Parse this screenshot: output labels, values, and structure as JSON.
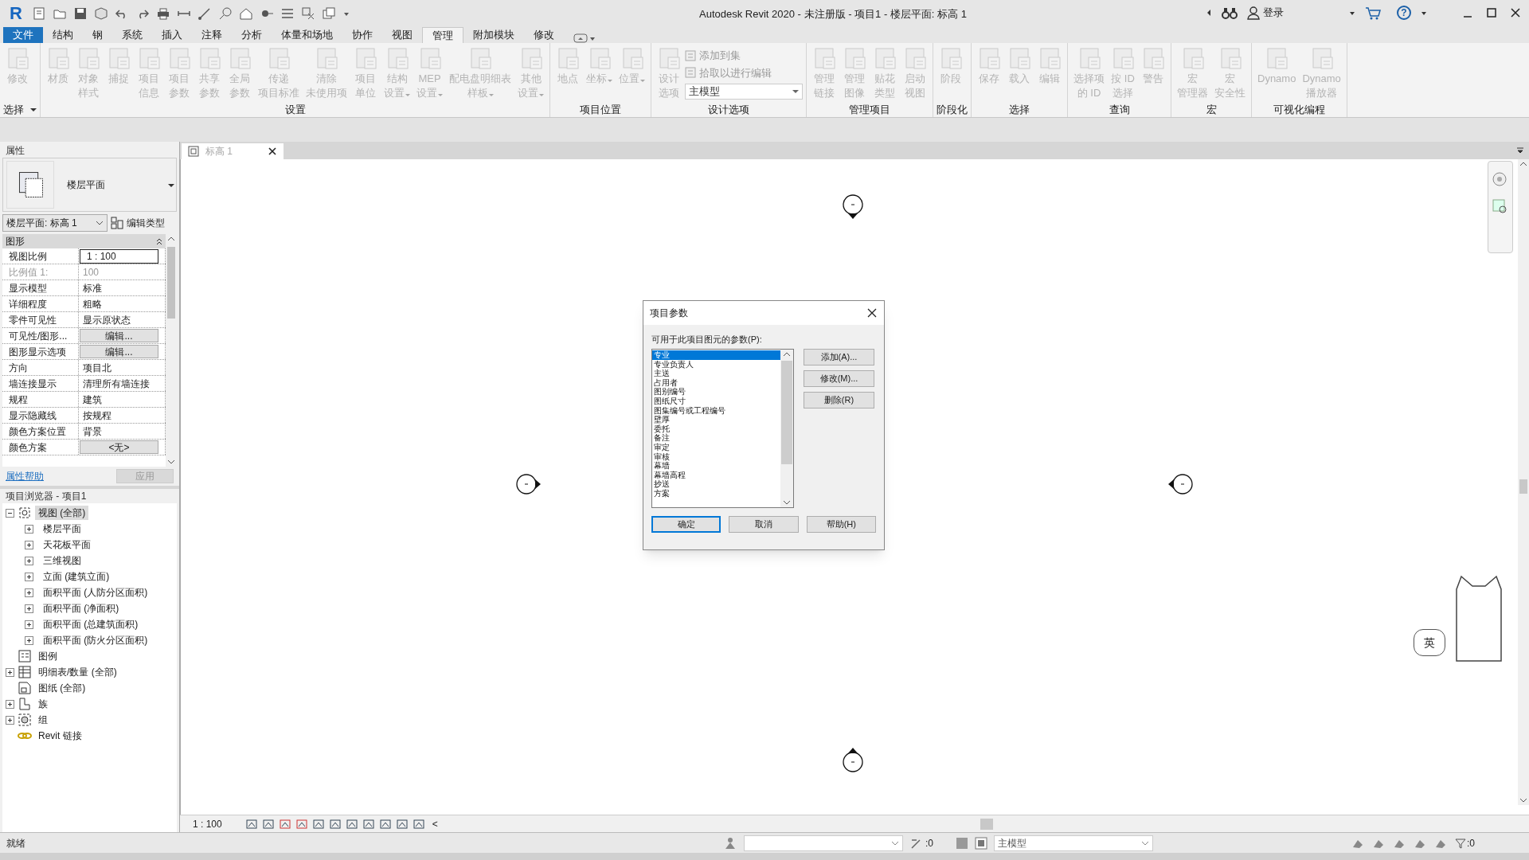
{
  "title_bar": {
    "logo": "R",
    "title": "Autodesk Revit 2020 - 未注册版 - 项目1 - 楼层平面: 标高 1",
    "sign_in": "登录",
    "help_glyph": "?"
  },
  "file_tab": "文件",
  "menu_tabs": [
    {
      "label": "结构",
      "selected": false
    },
    {
      "label": "钢",
      "selected": false
    },
    {
      "label": "系统",
      "selected": false
    },
    {
      "label": "插入",
      "selected": false
    },
    {
      "label": "注释",
      "selected": false
    },
    {
      "label": "分析",
      "selected": false
    },
    {
      "label": "体量和场地",
      "selected": false
    },
    {
      "label": "协作",
      "selected": false
    },
    {
      "label": "视图",
      "selected": false
    },
    {
      "label": "管理",
      "selected": true
    },
    {
      "label": "附加模块",
      "selected": false
    },
    {
      "label": "修改",
      "selected": false
    }
  ],
  "ribbon": [
    {
      "label": "选择",
      "dropdown": true,
      "tools": [
        {
          "label": [
            "修改"
          ],
          "disabled": true,
          "dropdown": false
        }
      ]
    },
    {
      "label": "设置",
      "dropdown": false,
      "tools": [
        {
          "label": [
            "材质"
          ],
          "disabled": true,
          "dropdown": false
        },
        {
          "label": [
            "对象",
            "样式"
          ],
          "disabled": true,
          "dropdown": false
        },
        {
          "label": [
            "捕捉"
          ],
          "disabled": true,
          "dropdown": false
        },
        {
          "label": [
            "项目",
            "信息"
          ],
          "disabled": true,
          "dropdown": false
        },
        {
          "label": [
            "项目",
            "参数"
          ],
          "disabled": true,
          "dropdown": false
        },
        {
          "label": [
            "共享",
            "参数"
          ],
          "disabled": true,
          "dropdown": false
        },
        {
          "label": [
            "全局",
            "参数"
          ],
          "disabled": true,
          "dropdown": false
        },
        {
          "label": [
            "传递",
            "项目标准"
          ],
          "disabled": true,
          "dropdown": false
        },
        {
          "label": [
            "清除",
            "未使用项"
          ],
          "disabled": true,
          "dropdown": false
        },
        {
          "label": [
            "项目",
            "单位"
          ],
          "disabled": true,
          "dropdown": false
        },
        {
          "label": [
            "结构",
            "设置"
          ],
          "disabled": true,
          "dropdown": true
        },
        {
          "label": [
            "MEP",
            "设置"
          ],
          "disabled": true,
          "dropdown": true
        },
        {
          "label": [
            "配电盘明细表",
            "样板"
          ],
          "disabled": true,
          "dropdown": true
        },
        {
          "label": [
            "其他",
            "设置"
          ],
          "disabled": true,
          "dropdown": true
        }
      ]
    },
    {
      "label": "项目位置",
      "dropdown": false,
      "tools": [
        {
          "label": [
            "地点"
          ],
          "disabled": true,
          "dropdown": false
        },
        {
          "label": [
            "坐标"
          ],
          "disabled": true,
          "dropdown": true
        },
        {
          "label": [
            "位置"
          ],
          "disabled": true,
          "dropdown": true
        }
      ]
    },
    {
      "label": "设计选项",
      "dropdown": false,
      "tools": [
        {
          "label": [
            "设计",
            "选项"
          ],
          "disabled": true,
          "dropdown": false
        }
      ],
      "small_tools": [
        "添加到集",
        "拾取以进行编辑"
      ],
      "select": "主模型"
    },
    {
      "label": "管理项目",
      "dropdown": false,
      "tools": [
        {
          "label": [
            "管理",
            "链接"
          ],
          "disabled": true,
          "dropdown": false
        },
        {
          "label": [
            "管理",
            "图像"
          ],
          "disabled": true,
          "dropdown": false
        },
        {
          "label": [
            "贴花",
            "类型"
          ],
          "disabled": true,
          "dropdown": false
        },
        {
          "label": [
            "启动",
            "视图"
          ],
          "disabled": true,
          "dropdown": false
        }
      ]
    },
    {
      "label": "阶段化",
      "dropdown": false,
      "tools": [
        {
          "label": [
            "阶段"
          ],
          "disabled": true,
          "dropdown": false
        }
      ]
    },
    {
      "label": "选择",
      "dropdown": false,
      "tools": [
        {
          "label": [
            "保存"
          ],
          "disabled": true,
          "dropdown": false
        },
        {
          "label": [
            "载入"
          ],
          "disabled": true,
          "dropdown": false
        },
        {
          "label": [
            "编辑"
          ],
          "disabled": true,
          "dropdown": false
        }
      ]
    },
    {
      "label": "查询",
      "dropdown": false,
      "tools": [
        {
          "label": [
            "选择项",
            "的 ID"
          ],
          "disabled": true,
          "dropdown": false
        },
        {
          "label": [
            "按 ID",
            "选择"
          ],
          "disabled": true,
          "dropdown": false
        },
        {
          "label": [
            "警告"
          ],
          "disabled": true,
          "dropdown": false
        }
      ]
    },
    {
      "label": "宏",
      "dropdown": false,
      "tools": [
        {
          "label": [
            "宏",
            "管理器"
          ],
          "disabled": true,
          "dropdown": false
        },
        {
          "label": [
            "宏",
            "安全性"
          ],
          "disabled": true,
          "dropdown": false
        }
      ]
    },
    {
      "label": "可视化编程",
      "dropdown": false,
      "tools": [
        {
          "label": [
            "Dynamo"
          ],
          "disabled": true,
          "dropdown": false
        },
        {
          "label": [
            "Dynamo",
            "播放器"
          ],
          "disabled": true,
          "dropdown": false
        }
      ]
    }
  ],
  "properties": {
    "title": "属性",
    "type_name": "楼层平面",
    "instance": "楼层平面: 标高 1",
    "edit_type": "编辑类型",
    "group": "图形",
    "rows": [
      {
        "name": "视图比例",
        "value": "1 : 100",
        "kind": "input",
        "disabled": false
      },
      {
        "name": "比例值 1:",
        "value": "100",
        "kind": "text",
        "disabled": true
      },
      {
        "name": "显示模型",
        "value": "标准",
        "kind": "text",
        "disabled": false
      },
      {
        "name": "详细程度",
        "value": "粗略",
        "kind": "text",
        "disabled": false
      },
      {
        "name": "零件可见性",
        "value": "显示原状态",
        "kind": "text",
        "disabled": false
      },
      {
        "name": "可见性/图形...",
        "value": "编辑...",
        "kind": "button",
        "disabled": false
      },
      {
        "name": "图形显示选项",
        "value": "编辑...",
        "kind": "button",
        "disabled": false
      },
      {
        "name": "方向",
        "value": "项目北",
        "kind": "text",
        "disabled": false
      },
      {
        "name": "墙连接显示",
        "value": "清理所有墙连接",
        "kind": "text",
        "disabled": false
      },
      {
        "name": "规程",
        "value": "建筑",
        "kind": "text",
        "disabled": false
      },
      {
        "name": "显示隐藏线",
        "value": "按规程",
        "kind": "text",
        "disabled": false
      },
      {
        "name": "颜色方案位置",
        "value": "背景",
        "kind": "text",
        "disabled": false
      },
      {
        "name": "颜色方案",
        "value": "<无>",
        "kind": "button",
        "disabled": false
      }
    ],
    "help_link": "属性帮助",
    "apply": "应用"
  },
  "browser": {
    "title": "项目浏览器 - 项目1",
    "tree": [
      {
        "label": "视图 (全部)",
        "expanded": true,
        "selected": true,
        "children": [
          {
            "label": "楼层平面",
            "expanded": false,
            "selected": false
          },
          {
            "label": "天花板平面",
            "expanded": false,
            "selected": false
          },
          {
            "label": "三维视图",
            "expanded": false,
            "selected": false
          },
          {
            "label": "立面 (建筑立面)",
            "expanded": false,
            "selected": false
          },
          {
            "label": "面积平面 (人防分区面积)",
            "expanded": false,
            "selected": false
          },
          {
            "label": "面积平面 (净面积)",
            "expanded": false,
            "selected": false
          },
          {
            "label": "面积平面 (总建筑面积)",
            "expanded": false,
            "selected": false
          },
          {
            "label": "面积平面 (防火分区面积)",
            "expanded": false,
            "selected": false
          }
        ]
      },
      {
        "label": "图例",
        "selected": false
      },
      {
        "label": "明细表/数量 (全部)",
        "expanded": false,
        "selected": false
      },
      {
        "label": "图纸 (全部)",
        "selected": false
      },
      {
        "label": "族",
        "expanded": false,
        "selected": false
      },
      {
        "label": "组",
        "expanded": false,
        "selected": false
      },
      {
        "label": "Revit 链接",
        "selected": false
      }
    ]
  },
  "view_tab": {
    "label": "标高 1"
  },
  "dialog": {
    "title": "项目参数",
    "prompt": "可用于此项目图元的参数(P):",
    "parameters": [
      {
        "label": "专业",
        "selected": true
      },
      {
        "label": "专业负责人",
        "selected": false
      },
      {
        "label": "主送",
        "selected": false
      },
      {
        "label": "占用者",
        "selected": false
      },
      {
        "label": "图别编号",
        "selected": false
      },
      {
        "label": "图纸尺寸",
        "selected": false
      },
      {
        "label": "图集编号或工程编号",
        "selected": false
      },
      {
        "label": "壁厚",
        "selected": false
      },
      {
        "label": "委托",
        "selected": false
      },
      {
        "label": "备注",
        "selected": false
      },
      {
        "label": "审定",
        "selected": false
      },
      {
        "label": "审核",
        "selected": false
      },
      {
        "label": "幕墙",
        "selected": false
      },
      {
        "label": "幕墙高程",
        "selected": false
      },
      {
        "label": "抄送",
        "selected": false
      },
      {
        "label": "方案",
        "selected": false
      }
    ],
    "side_buttons": [
      "添加(A)...",
      "修改(M)...",
      "删除(R)"
    ],
    "buttons": [
      {
        "label": "确定",
        "default": true
      },
      {
        "label": "取消",
        "default": false
      },
      {
        "label": "帮助(H)",
        "default": false
      }
    ]
  },
  "ime": {
    "label": "英"
  },
  "view_bar": {
    "scale": "1 : 100",
    "collapse": "<"
  },
  "status_bar": {
    "message": "就绪",
    "count": ":0",
    "model": "主模型",
    "filter_count": ":0"
  }
}
